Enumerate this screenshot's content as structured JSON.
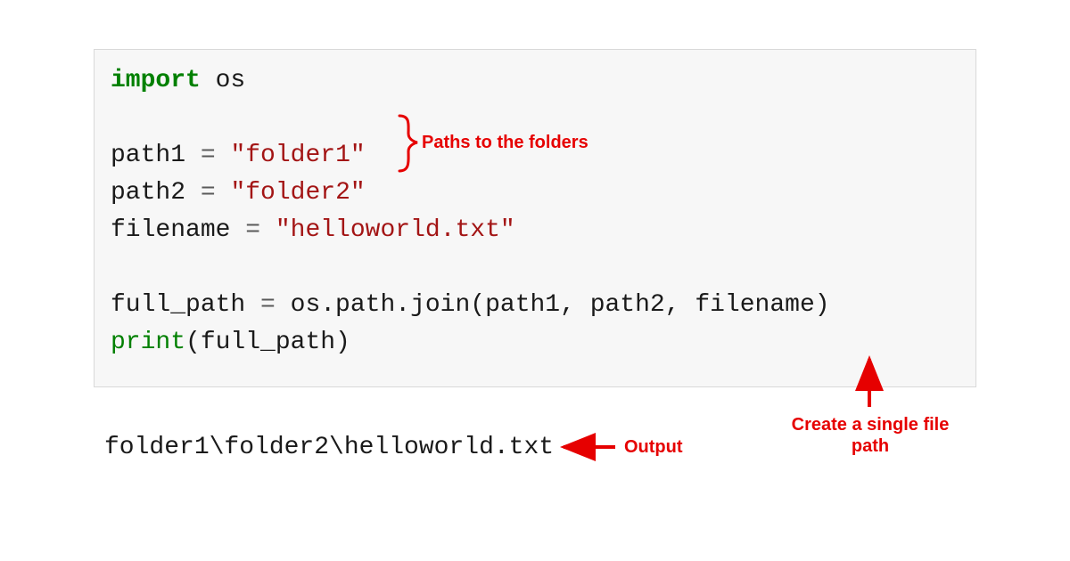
{
  "code": {
    "line1_kw": "import",
    "line1_mod": " os",
    "line3_lhs": "path1 ",
    "line3_op": "=",
    "line3_rhs": " \"folder1\"",
    "line4_lhs": "path2 ",
    "line4_op": "=",
    "line4_rhs": " \"folder2\"",
    "line5_lhs": "filename ",
    "line5_op": "=",
    "line5_rhs": " \"helloworld.txt\"",
    "line7_lhs": "full_path ",
    "line7_op": "=",
    "line7_rhs": " os.path.join(path1, path2, filename)",
    "line8_fn": "print",
    "line8_arg": "(full_path)"
  },
  "output": "folder1\\folder2\\helloworld.txt",
  "annotations": {
    "paths": "Paths to the folders",
    "output": "Output",
    "create_line1": "Create a single file",
    "create_line2": "path"
  },
  "colors": {
    "annotation": "#e60000",
    "keyword": "#008000",
    "string": "#a31515"
  }
}
